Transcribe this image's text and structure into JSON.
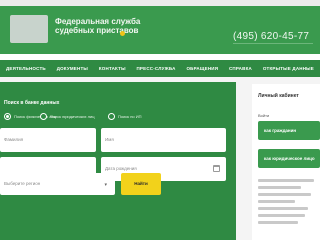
{
  "topbar": {
    "link": ""
  },
  "header": {
    "title": "Федеральная служба судебных приставов",
    "phone": "(495) 620-45-77",
    "note": "",
    "sub": ""
  },
  "nav": {
    "items": [
      "Деятельность",
      "Документы",
      "Контакты",
      "Пресс-служба",
      "Обращения",
      "Справка",
      "Открытые данные"
    ]
  },
  "search": {
    "title": "Поиск в банке данных",
    "radios": [
      {
        "label": "Поиск физических лиц",
        "selected": true
      },
      {
        "label": "Поиск юридических лиц",
        "selected": false
      },
      {
        "label": "Поиск по ИП",
        "selected": false
      }
    ],
    "fields": {
      "last_name": "Фамилия",
      "first_name": "Имя",
      "middle_name": "",
      "birth_date": "Дата рождения",
      "region": "Выберите регион"
    },
    "submit": "Найти"
  },
  "cabinet": {
    "title": "Личный кабинет",
    "login_label": "Войти",
    "button_1": "как гражданин",
    "button_2": "как юридическое лицо"
  },
  "colors": {
    "brand_green": "#3a9a4e",
    "nav_green": "#2f8a43",
    "accent_yellow": "#f2d21b"
  }
}
